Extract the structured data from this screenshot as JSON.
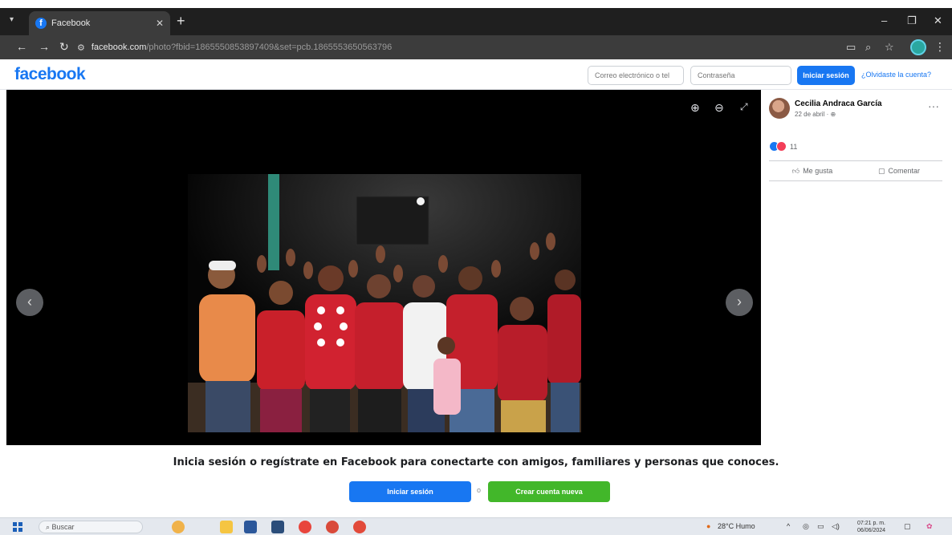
{
  "browser": {
    "tab_title": "Facebook",
    "url_host": "facebook.com",
    "url_path": "/photo?fbid=1865550853897409&set=pcb.1865553650563796"
  },
  "header": {
    "logo": "facebook",
    "email_placeholder": "Correo electrónico o tel",
    "password_placeholder": "Contraseña",
    "login_label": "Iniciar sesión",
    "forgot_label": "¿Olvidaste la cuenta?"
  },
  "post": {
    "author": "Cecilia Andraca García",
    "date": "22 de abril · ",
    "reactions_count": "11",
    "like_label": "Me gusta",
    "comment_label": "Comentar"
  },
  "prompt": {
    "text": "Inicia sesión o regístrate en Facebook para conectarte con amigos, familiares y personas que conoces.",
    "login_label": "Iniciar sesión",
    "or": "o",
    "create_label": "Crear cuenta nueva"
  },
  "taskbar": {
    "search_placeholder": "Buscar",
    "weather": "28°C Humo",
    "time": "07:21 p. m.",
    "date": "06/06/2024"
  },
  "colors": {
    "fb_blue": "#1877f2",
    "create_green": "#42b72a",
    "viewer_bg": "#000000"
  }
}
